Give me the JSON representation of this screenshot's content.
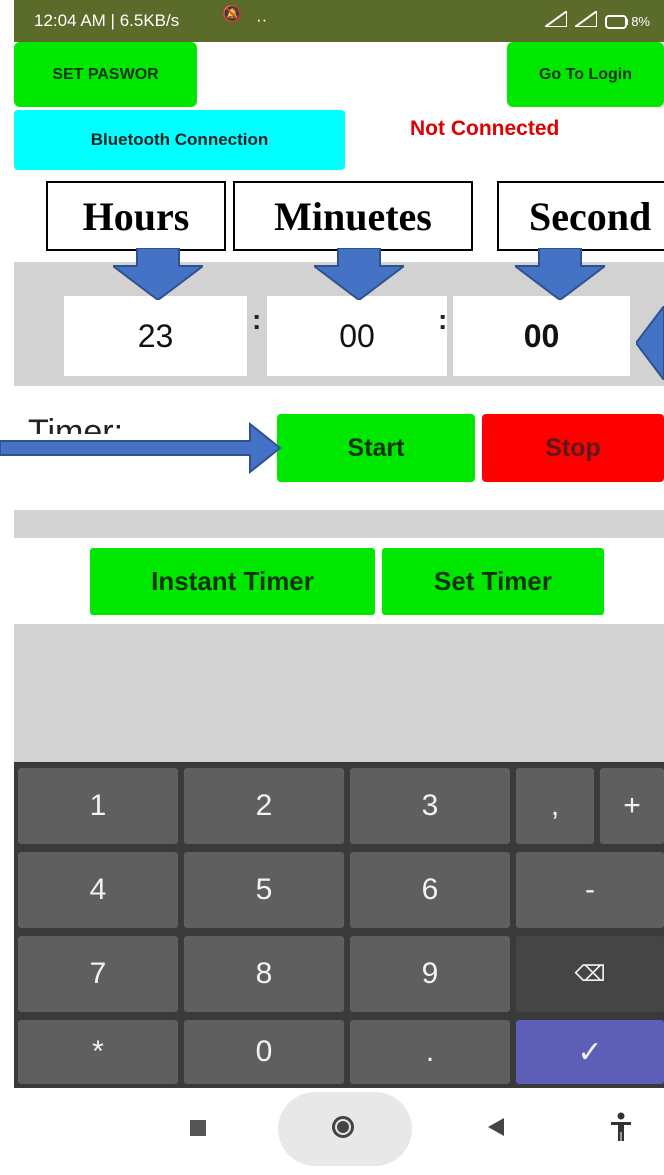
{
  "statusbar": {
    "time_info": "12:04 AM | 6.5KB/s",
    "extra": "··",
    "battery_label": "8%"
  },
  "buttons": {
    "set_password": "SET PASWOR",
    "go_to_login": "Go To Login",
    "bluetooth": "Bluetooth Connection",
    "start": "Start",
    "stop": "Stop",
    "instant_timer": "Instant Timer",
    "set_timer": "Set Timer"
  },
  "connection_status": "Not Connected",
  "annotation_labels": {
    "hours": "Hours",
    "minutes": "Minuetes",
    "seconds": "Second"
  },
  "time_fields": {
    "hours": "23",
    "minutes": "00",
    "seconds": "00",
    "separator": ":"
  },
  "timer_label": "Timer:",
  "keyboard": {
    "rows": [
      [
        "1",
        "2",
        "3",
        ",",
        "+"
      ],
      [
        "4",
        "5",
        "6",
        "-"
      ],
      [
        "7",
        "8",
        "9",
        "⌫"
      ],
      [
        "*",
        "0",
        ".",
        "✓"
      ]
    ]
  },
  "colors": {
    "green": "#00e800",
    "red": "#ff0000",
    "cyan": "#00ffff",
    "status_red": "#e00000",
    "arrow_blue": "#4472c4",
    "key_gray": "#5f5f5f",
    "done_key": "#5c5fb5"
  }
}
